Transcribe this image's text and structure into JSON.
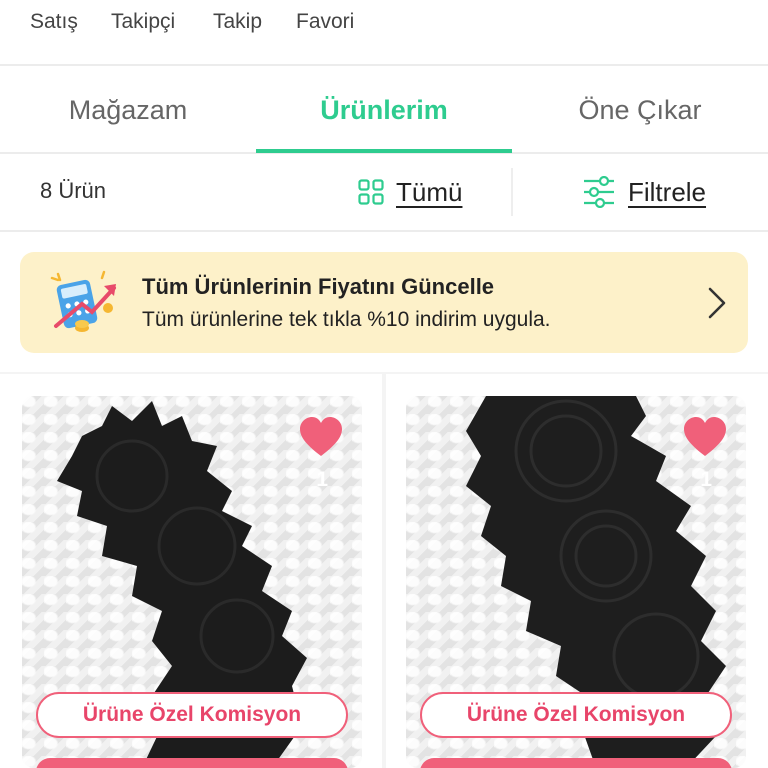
{
  "stats": {
    "items": [
      "Satış",
      "Takipçi",
      "Takip",
      "Favori"
    ]
  },
  "tabs": [
    {
      "label": "Mağazam",
      "active": false
    },
    {
      "label": "Ürünlerim",
      "active": true
    },
    {
      "label": "Öne Çıkar",
      "active": false
    }
  ],
  "toolbar": {
    "count": "8 Ürün",
    "all_label": "Tümü",
    "filter_label": "Filtrele"
  },
  "banner": {
    "title": "Tüm Ürünlerinin Fiyatını Güncelle",
    "subtitle": "Tüm ürünlerine tek tıkla %10 indirim uygula.",
    "icon": "calculator-price-up-icon",
    "background": "#fdf1c9"
  },
  "products": [
    {
      "favorites": "1",
      "commission_label": "Ürüne Özel Komisyon"
    },
    {
      "favorites": "1",
      "commission_label": "Ürüne Özel Komisyon"
    }
  ],
  "colors": {
    "accent": "#2ecc8f",
    "heart": "#f0607a",
    "commission": "#e8456a"
  }
}
